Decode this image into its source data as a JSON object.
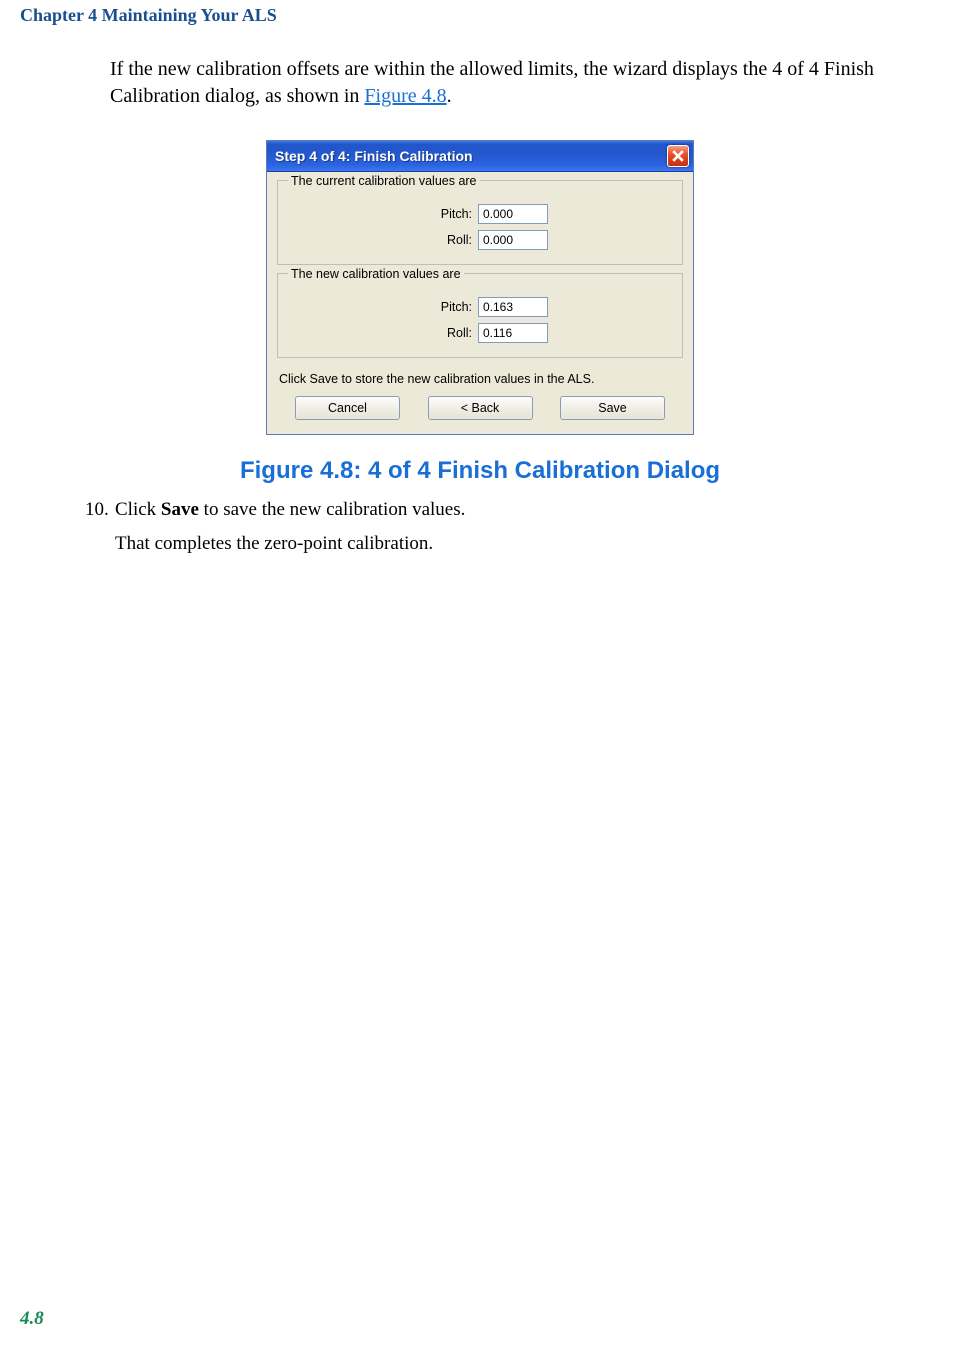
{
  "chapter_header": "Chapter 4  Maintaining Your ALS",
  "intro": {
    "pre": "If the new calibration offsets are within the allowed limits, the wizard displays the 4 of 4 Finish Calibration dialog, as shown in ",
    "link": "Figure 4.8",
    "post": "."
  },
  "dialog": {
    "title": "Step 4 of 4:   Finish Calibration",
    "group1_legend": "The current calibration values are",
    "group2_legend": "The new calibration values are",
    "pitch_label": "Pitch:",
    "roll_label": "Roll:",
    "current_pitch": "0.000",
    "current_roll": "0.000",
    "new_pitch": "0.163",
    "new_roll": "0.116",
    "instruction": "Click Save to store the new calibration values in the ALS.",
    "cancel": "Cancel",
    "back": "<  Back",
    "save": "Save"
  },
  "figure_caption": "Figure 4.8: 4 of 4 Finish Calibration Dialog",
  "step": {
    "num": "10.",
    "text_pre": "Click ",
    "text_bold": "Save",
    "text_post": " to save the new calibration values."
  },
  "step_sub": "That completes the zero-point calibration.",
  "page_num": "4.8"
}
